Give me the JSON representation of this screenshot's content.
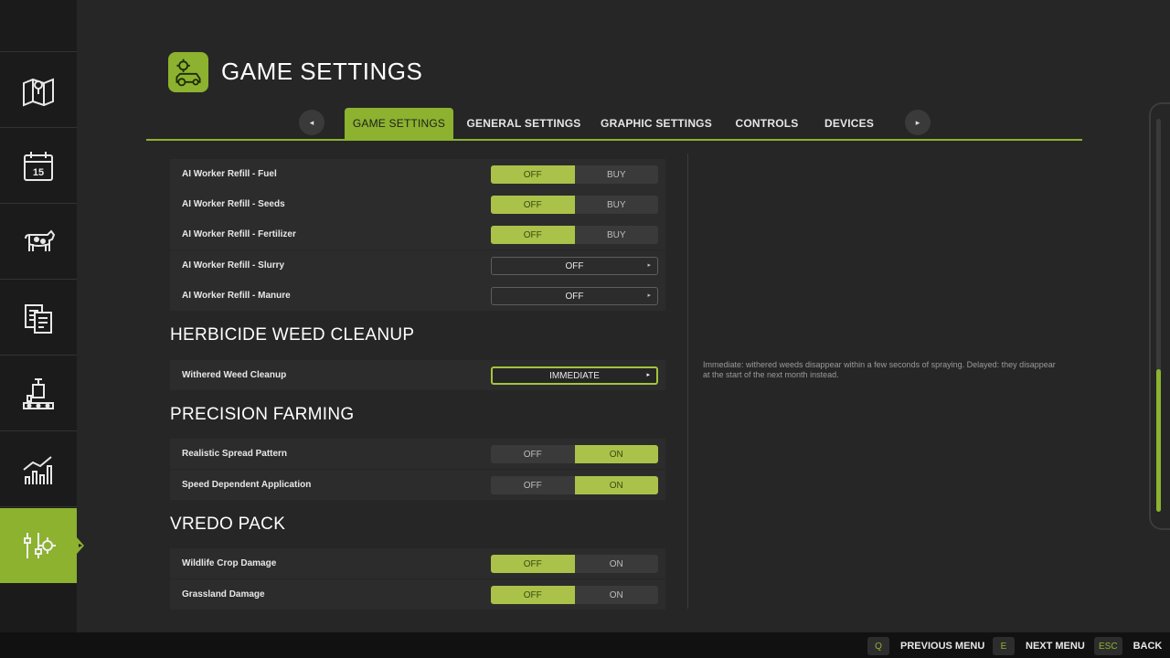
{
  "header": {
    "title": "GAME SETTINGS"
  },
  "sidebar": {
    "items": [
      {
        "icon": "map-icon"
      },
      {
        "icon": "calendar-icon",
        "calendar_day": "15"
      },
      {
        "icon": "livestock-icon"
      },
      {
        "icon": "contracts-icon"
      },
      {
        "icon": "production-icon"
      },
      {
        "icon": "statistics-icon"
      },
      {
        "icon": "settings-icon",
        "active": true
      }
    ]
  },
  "tabs": {
    "prev_glyph": "◂",
    "next_glyph": "▸",
    "items": [
      {
        "label": "GAME SETTINGS",
        "active": true
      },
      {
        "label": "GENERAL SETTINGS"
      },
      {
        "label": "GRAPHIC SETTINGS"
      },
      {
        "label": "CONTROLS"
      },
      {
        "label": "DEVICES"
      }
    ]
  },
  "settings": {
    "ai_refill_fuel": {
      "label": "AI Worker Refill - Fuel",
      "options": [
        "OFF",
        "BUY"
      ],
      "selected": "OFF"
    },
    "ai_refill_seeds": {
      "label": "AI Worker Refill - Seeds",
      "options": [
        "OFF",
        "BUY"
      ],
      "selected": "OFF"
    },
    "ai_refill_fertilizer": {
      "label": "AI Worker Refill - Fertilizer",
      "options": [
        "OFF",
        "BUY"
      ],
      "selected": "OFF"
    },
    "ai_refill_slurry": {
      "label": "AI Worker Refill - Slurry",
      "value": "OFF"
    },
    "ai_refill_manure": {
      "label": "AI Worker Refill - Manure",
      "value": "OFF"
    }
  },
  "sections": {
    "herbicide": {
      "title": "HERBICIDE WEED CLEANUP",
      "withered_weed": {
        "label": "Withered Weed Cleanup",
        "value": "IMMEDIATE"
      }
    },
    "precision": {
      "title": "PRECISION FARMING",
      "spread_pattern": {
        "label": "Realistic Spread Pattern",
        "options": [
          "OFF",
          "ON"
        ],
        "selected": "ON"
      },
      "speed_dependent": {
        "label": "Speed Dependent Application",
        "options": [
          "OFF",
          "ON"
        ],
        "selected": "ON"
      }
    },
    "vredo": {
      "title": "VREDO PACK",
      "wildlife_damage": {
        "label": "Wildlife Crop Damage",
        "options": [
          "OFF",
          "ON"
        ],
        "selected": "OFF"
      },
      "grassland_damage": {
        "label": "Grassland Damage",
        "options": [
          "OFF",
          "ON"
        ],
        "selected": "OFF"
      }
    }
  },
  "description": "Immediate: withered weeds disappear within a few seconds of spraying. Delayed: they disappear at the start of the next month instead.",
  "footer": {
    "previous": {
      "key": "Q",
      "label": "PREVIOUS MENU"
    },
    "next": {
      "key": "E",
      "label": "NEXT MENU"
    },
    "back": {
      "key": "ESC",
      "label": "BACK"
    }
  },
  "colors": {
    "accent": "#8cb22f",
    "toggle_on": "#aac249",
    "background": "#262626",
    "sidebar": "#1b1b1b"
  }
}
